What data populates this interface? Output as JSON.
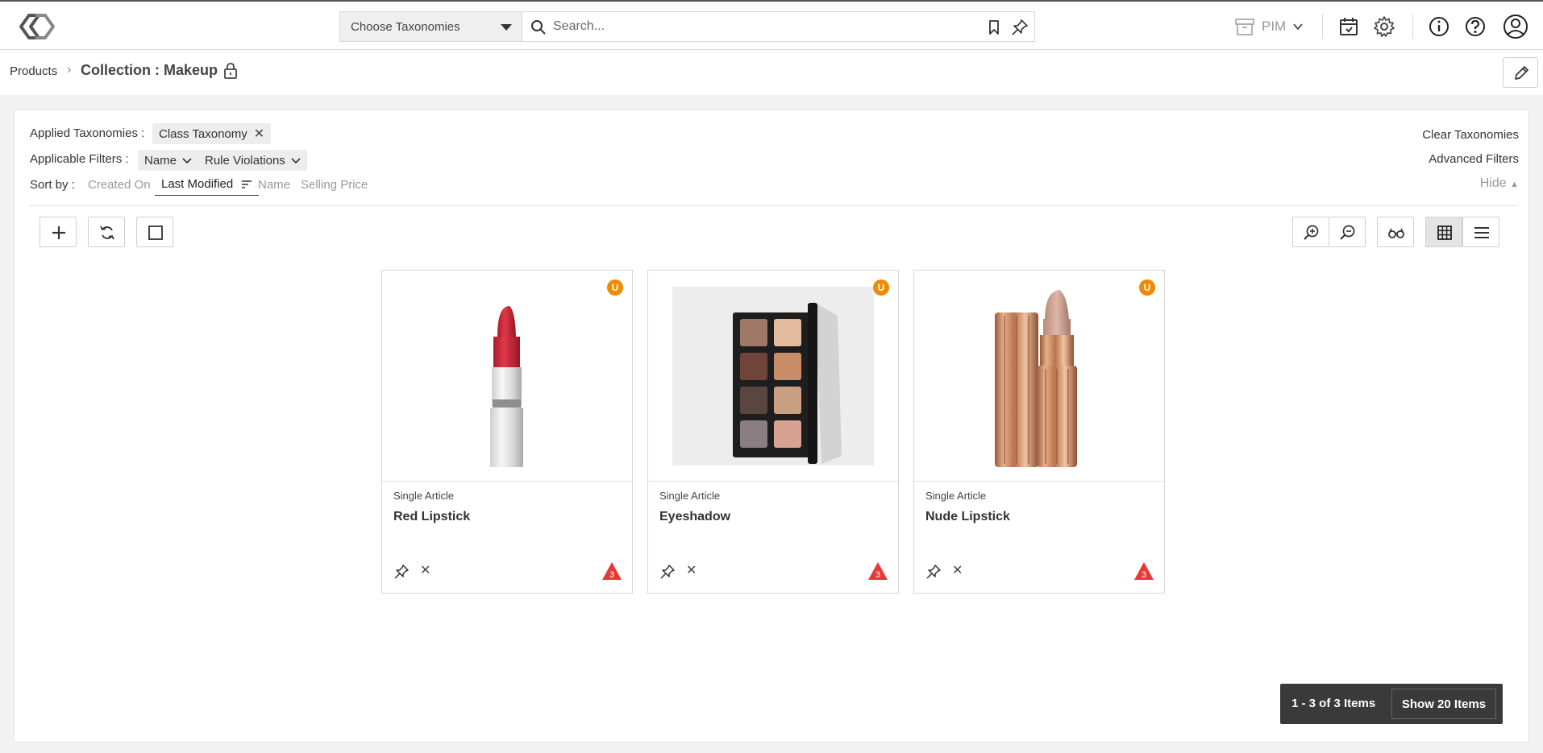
{
  "topbar": {
    "taxonomy_select": "Choose Taxonomies",
    "search_placeholder": "Search...",
    "app_switch": "PIM"
  },
  "breadcrumb": {
    "root": "Products",
    "separator": "›",
    "title": "Collection : Makeup"
  },
  "filters": {
    "applied_label": "Applied Taxonomies :",
    "applied_chips": [
      "Class Taxonomy"
    ],
    "applicable_label": "Applicable Filters :",
    "applicable_chips": [
      "Name",
      "Rule Violations"
    ],
    "clear_label": "Clear Taxonomies",
    "advanced_label": "Advanced Filters",
    "hide_label": "Hide",
    "sort_label": "Sort by :",
    "sort_options": [
      "Created On",
      "Last Modified",
      "Name",
      "Selling Price"
    ],
    "sort_active": "Last Modified"
  },
  "cards": [
    {
      "type": "Single Article",
      "name": "Red Lipstick",
      "badge": "U",
      "warnings": "3"
    },
    {
      "type": "Single Article",
      "name": "Eyeshadow",
      "badge": "U",
      "warnings": "3"
    },
    {
      "type": "Single Article",
      "name": "Nude Lipstick",
      "badge": "U",
      "warnings": "3"
    }
  ],
  "pager": {
    "count": "1 - 3 of 3 Items",
    "show": "Show 20 Items"
  },
  "colors": {
    "accent_badge": "#f08a00",
    "warning": "#e53935",
    "pager_bg": "#3a3a3a"
  }
}
